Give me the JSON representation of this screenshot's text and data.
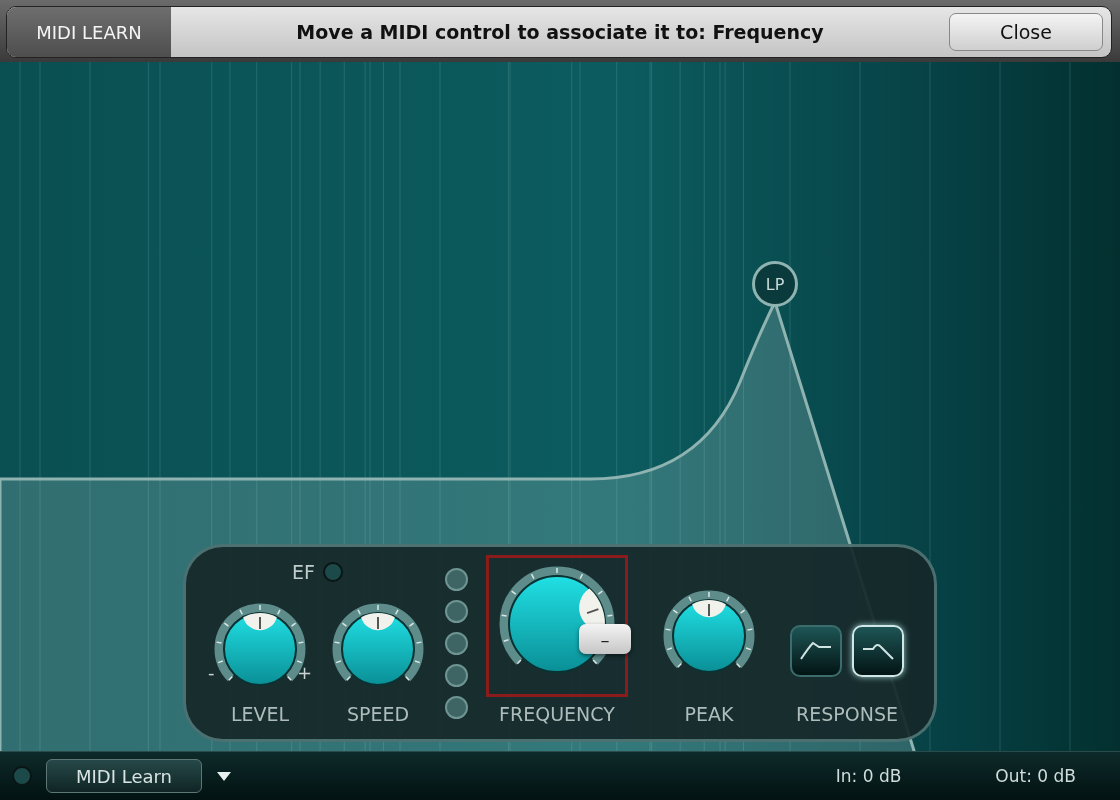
{
  "banner": {
    "label": "MIDI LEARN",
    "message": "Move a MIDI control to associate it to: Frequency",
    "close": "Close"
  },
  "graph": {
    "node": "LP"
  },
  "panel": {
    "ef": {
      "label": "EF",
      "on": false
    },
    "left_knobs": [
      {
        "label": "LEVEL",
        "level": 0.5,
        "min": "-",
        "max": "+"
      },
      {
        "label": "SPEED",
        "level": 0.5
      }
    ],
    "right_knobs": [
      {
        "kind": "large",
        "label": "FREQUENCY",
        "level": 0.76,
        "midi_target": true,
        "tooltip": "–"
      },
      {
        "kind": "small",
        "label": "PEAK",
        "level": 0.5,
        "midi_target": false
      }
    ],
    "response": {
      "label": "RESPONSE",
      "options": [
        {
          "kind": "peak",
          "selected": false
        },
        {
          "kind": "plateau",
          "selected": true
        }
      ]
    }
  },
  "status_bar": {
    "led_on": false,
    "midi_button": "MIDI Learn",
    "input": "In: 0 dB",
    "output": "Out: 0 dB"
  }
}
